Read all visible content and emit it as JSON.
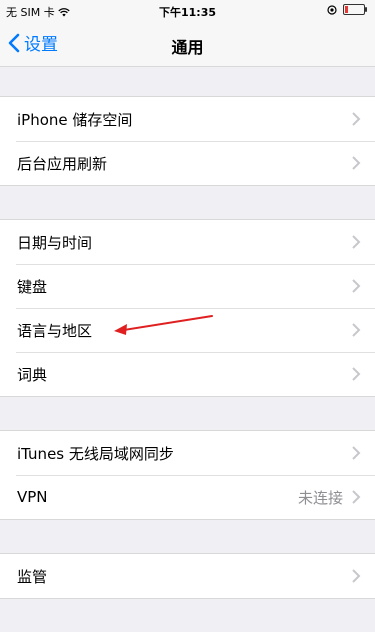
{
  "status_bar": {
    "carrier": "无 SIM 卡",
    "time": "下午11:35",
    "icons": [
      "wifi-icon",
      "location-icon",
      "battery-icon"
    ],
    "battery_color": "#e53935"
  },
  "nav": {
    "back_label": "设置",
    "title": "通用",
    "accent_color": "#007aff"
  },
  "groups": [
    {
      "items": [
        {
          "label": "iPhone 储存空间"
        },
        {
          "label": "后台应用刷新"
        }
      ]
    },
    {
      "items": [
        {
          "label": "日期与时间"
        },
        {
          "label": "键盘"
        },
        {
          "label": "语言与地区"
        },
        {
          "label": "词典"
        }
      ]
    },
    {
      "items": [
        {
          "label": "iTunes 无线局域网同步"
        },
        {
          "label": "VPN",
          "value": "未连接"
        }
      ]
    },
    {
      "items": [
        {
          "label": "监管"
        }
      ]
    }
  ],
  "annotation": {
    "arrow_color": "#e02020"
  }
}
